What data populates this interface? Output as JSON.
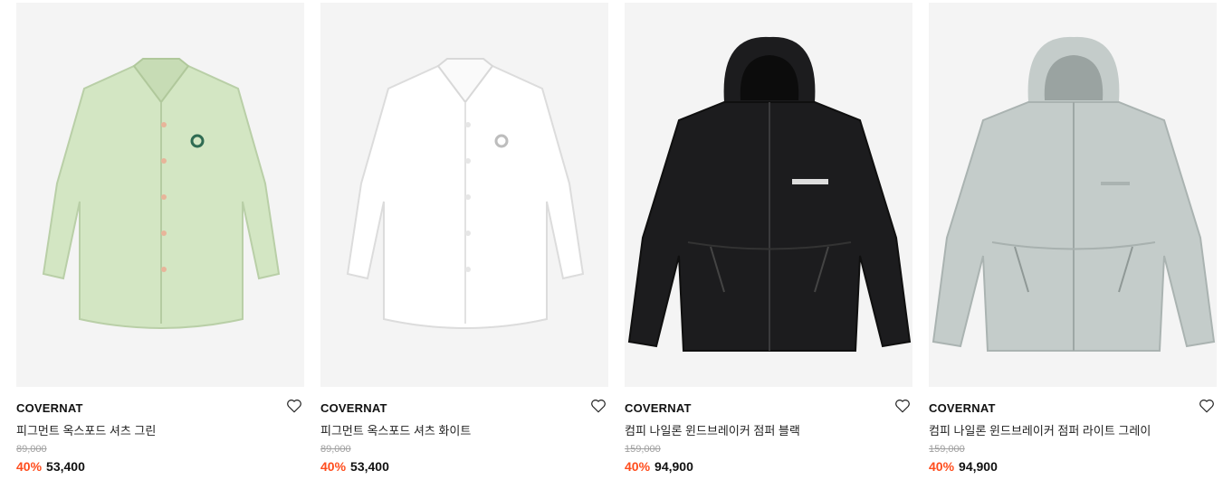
{
  "products": [
    {
      "brand": "COVERNAT",
      "name": "피그먼트 옥스포드 셔츠 그린",
      "original_price": "89,000",
      "discount": "40%",
      "sale_price": "53,400",
      "image_icon": "green-oxford-shirt",
      "color": "#d3e6c3"
    },
    {
      "brand": "COVERNAT",
      "name": "피그먼트 옥스포드 셔츠 화이트",
      "original_price": "89,000",
      "discount": "40%",
      "sale_price": "53,400",
      "image_icon": "white-oxford-shirt",
      "color": "#ffffff"
    },
    {
      "brand": "COVERNAT",
      "name": "컴피 나일론 윈드브레이커 점퍼 블랙",
      "original_price": "159,000",
      "discount": "40%",
      "sale_price": "94,900",
      "image_icon": "black-windbreaker-jacket",
      "color": "#1c1c1e"
    },
    {
      "brand": "COVERNAT",
      "name": "컴피 나일론 윈드브레이커 점퍼 라이트 그레이",
      "original_price": "159,000",
      "discount": "40%",
      "sale_price": "94,900",
      "image_icon": "light-grey-windbreaker-jacket",
      "color": "#c4ccca"
    }
  ],
  "colors": {
    "discount": "#ff4d1d",
    "thumb_bg": "#f4f4f4",
    "strike_price": "#a0a0a0"
  }
}
